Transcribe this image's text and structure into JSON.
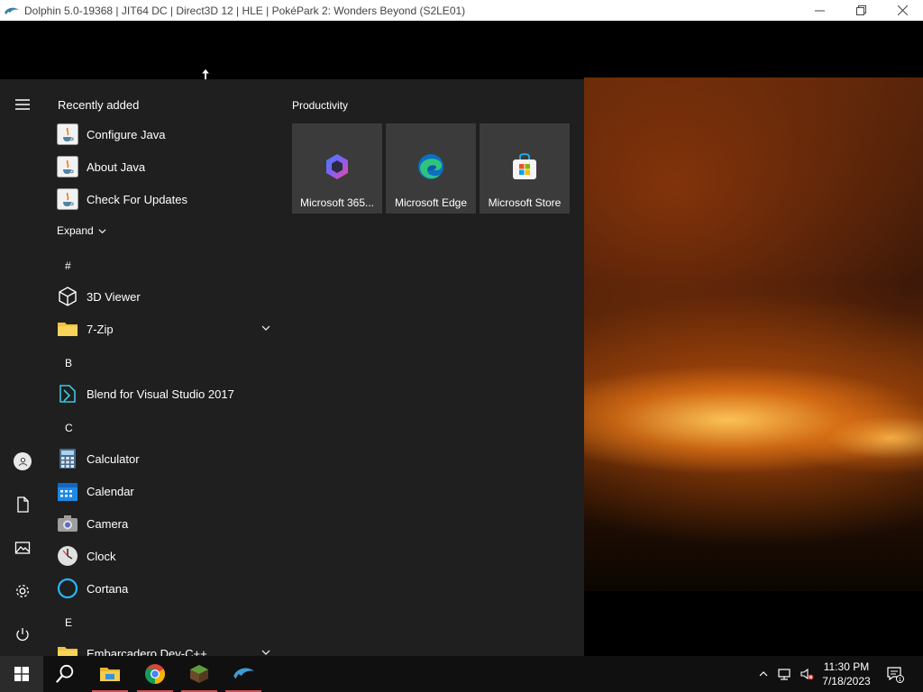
{
  "window": {
    "title": "Dolphin 5.0-19368 | JIT64 DC | Direct3D 12 | HLE | PokéPark 2: Wonders Beyond (S2LE01)"
  },
  "start_menu": {
    "recently_added_heading": "Recently added",
    "recently_added": [
      "Configure Java",
      "About Java",
      "Check For Updates"
    ],
    "expand_label": "Expand",
    "groups": [
      {
        "letter": "#",
        "apps": [
          "3D Viewer",
          "7-Zip"
        ]
      },
      {
        "letter": "B",
        "apps": [
          "Blend for Visual Studio 2017"
        ]
      },
      {
        "letter": "C",
        "apps": [
          "Calculator",
          "Calendar",
          "Camera",
          "Clock",
          "Cortana"
        ]
      },
      {
        "letter": "E",
        "apps": [
          "Embarcadero Dev-C++"
        ]
      }
    ],
    "tiles_group": "Productivity",
    "tiles": [
      "Microsoft 365...",
      "Microsoft Edge",
      "Microsoft Store"
    ]
  },
  "taskbar": {
    "apps": [
      "search-icon",
      "file-explorer-icon",
      "chrome-icon",
      "minecraft-icon",
      "dolphin-icon"
    ],
    "clock": {
      "time": "11:30 PM",
      "date": "7/18/2023"
    },
    "notification_count": "1"
  }
}
